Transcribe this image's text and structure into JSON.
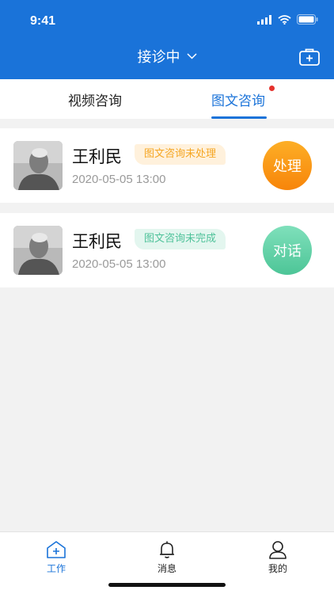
{
  "status_bar": {
    "time": "9:41"
  },
  "header": {
    "title": "接诊中",
    "accent": "#1a73d9"
  },
  "tabs": [
    {
      "label": "视频咨询",
      "active": false
    },
    {
      "label": "图文咨询",
      "active": true,
      "has_dot": true
    }
  ],
  "consultations": [
    {
      "name": "王利民",
      "badge": "图文咨询未处理",
      "badge_color": "#f5a623",
      "date": "2020-05-05 13:00",
      "action": "处理",
      "action_color": "#f7850a"
    },
    {
      "name": "王利民",
      "badge": "图文咨询未完成",
      "badge_color": "#4fc29a",
      "date": "2020-05-05 13:00",
      "action": "对话",
      "action_color": "#4dc597"
    }
  ],
  "tabbar": [
    {
      "label": "工作",
      "icon": "home-plus-icon",
      "active": true
    },
    {
      "label": "消息",
      "icon": "bell-icon",
      "active": false
    },
    {
      "label": "我的",
      "icon": "person-icon",
      "active": false
    }
  ]
}
